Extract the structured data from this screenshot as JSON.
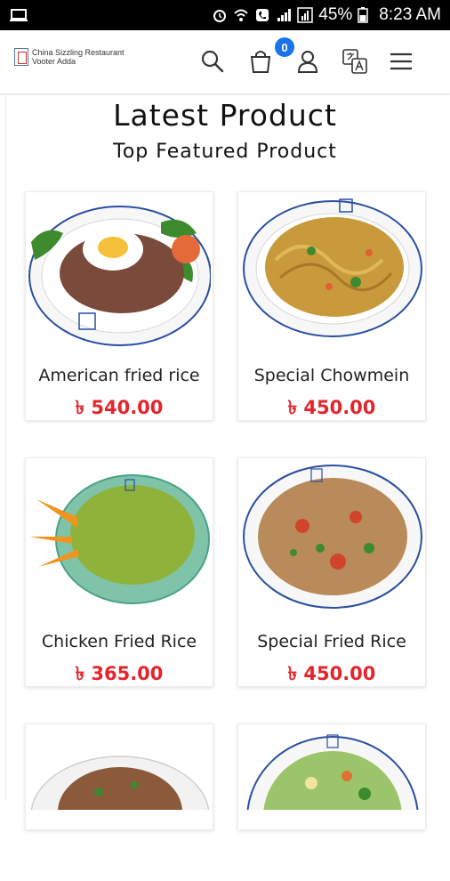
{
  "status_bar": {
    "battery_percent": "45%",
    "time": "8:23 AM"
  },
  "header": {
    "logo_line1": "China Sizzling Restaurant",
    "logo_line2": "Vooter Adda",
    "cart_count": "0",
    "icons": [
      "search-icon",
      "cart-icon",
      "user-icon",
      "translate-icon",
      "menu-icon"
    ]
  },
  "section": {
    "title": "Latest Product",
    "subtitle": "Top Featured Product"
  },
  "products": [
    {
      "name": "American fried rice",
      "price": "৳ 540.00"
    },
    {
      "name": "Special Chowmein",
      "price": "৳ 450.00"
    },
    {
      "name": "Chicken Fried Rice",
      "price": "৳ 365.00"
    },
    {
      "name": "Special Fried Rice",
      "price": "৳ 450.00"
    }
  ],
  "colors": {
    "accent": "#1a73e8",
    "price": "#e4252d",
    "status_bar": "#000000"
  }
}
